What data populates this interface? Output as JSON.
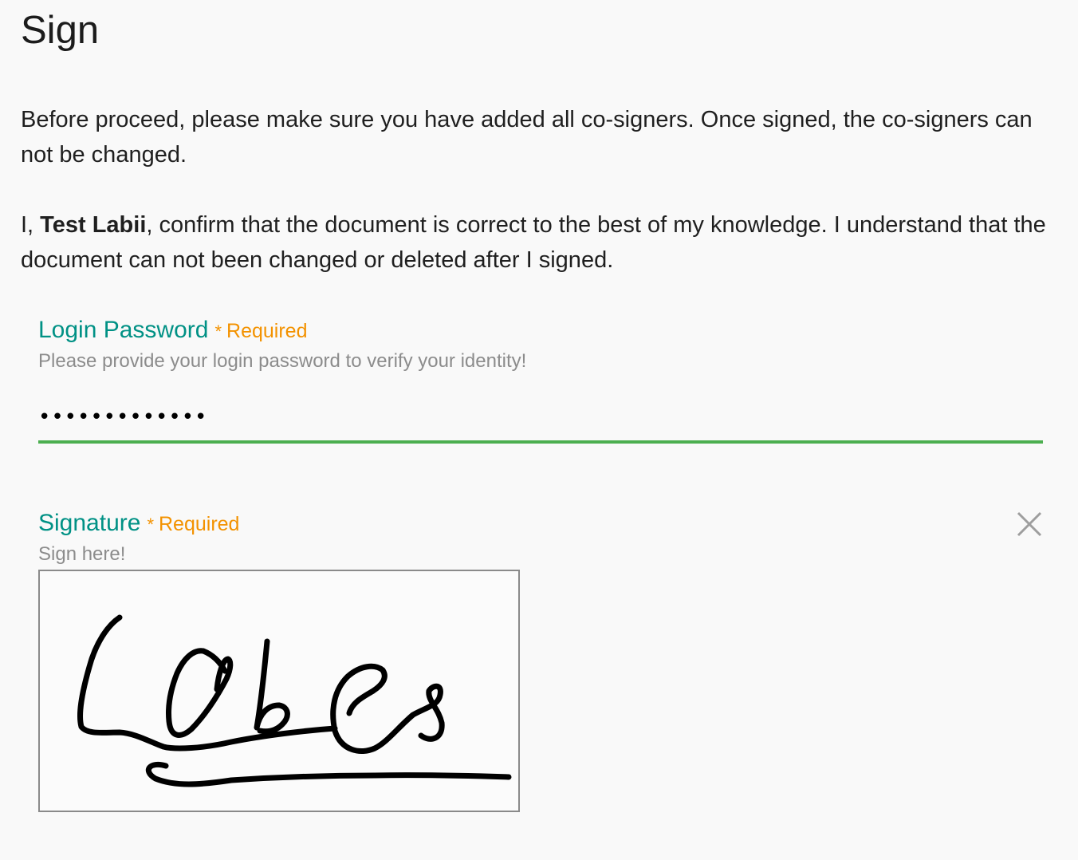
{
  "page": {
    "title": "Sign"
  },
  "notice": {
    "text": "Before proceed, please make sure you have added all co-signers. Once signed, the co-signers can not be changed."
  },
  "confirmation": {
    "prefix": "I, ",
    "name": "Test Labii",
    "suffix": ", confirm that the document is correct to the best of my knowledge. I understand that the document can not been changed or deleted after I signed."
  },
  "password_field": {
    "label": "Login Password",
    "required_star": "*",
    "required_text": "Required",
    "helper": "Please provide your login password to verify your identity!",
    "value": "•••••••••••••"
  },
  "signature_field": {
    "label": "Signature",
    "required_star": "*",
    "required_text": "Required",
    "helper": "Sign here!",
    "clear_icon": "close-icon"
  },
  "colors": {
    "label": "#009185",
    "required": "#f39200",
    "underline_active": "#4caf50",
    "helper": "#8c8c8c"
  }
}
